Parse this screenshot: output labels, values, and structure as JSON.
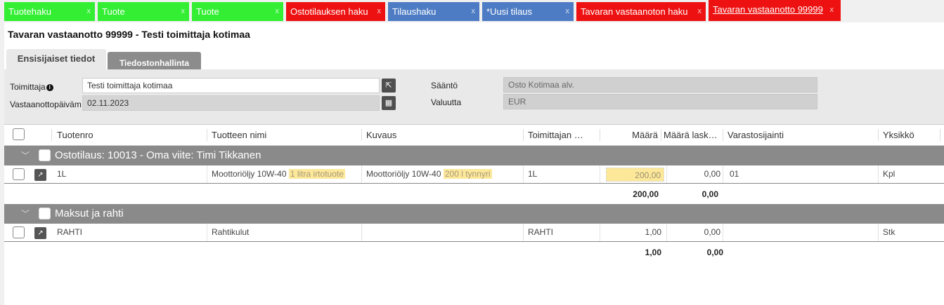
{
  "tabs": [
    {
      "label": "Tuotehaku",
      "close": "x"
    },
    {
      "label": "Tuote",
      "close": "x"
    },
    {
      "label": "Tuote",
      "close": "x"
    },
    {
      "label": "Ostotilauksen haku",
      "close": "x"
    },
    {
      "label": "Tilaushaku",
      "close": "x"
    },
    {
      "label": "*Uusi tilaus",
      "close": "x"
    },
    {
      "label": "Tavaran vastaanoton haku",
      "close": "x"
    },
    {
      "label": "Tavaran vastaanotto 99999",
      "close": "x"
    }
  ],
  "colors": {
    "green": "#33ee33",
    "red": "#ee1111",
    "blue": "#4d7cc4",
    "group": "#8a8a8a",
    "highlight": "#fde89a"
  },
  "page_title": "Tavaran vastaanotto 99999 - Testi toimittaja kotimaa",
  "subtabs": {
    "primary": "Ensisijaiset tiedot",
    "files": "Tiedostonhallinta"
  },
  "form": {
    "supplier_label": "Toimittaja",
    "supplier_info_icon": "i",
    "supplier_value": "Testi toimittaja kotimaa",
    "supplier_icon": "external-link-icon",
    "date_label": "Vastaanottopäivämäärä",
    "date_value": "02.11.2023",
    "date_icon": "calendar-icon",
    "rule_label": "Sääntö",
    "rule_value": "Osto Kotimaa alv.",
    "currency_label": "Valuutta",
    "currency_value": "EUR"
  },
  "columns": [
    "Tuotenro",
    "Tuotteen nimi",
    "Kuvaus",
    "Toimittajan tuotenumero",
    "Määrä",
    "Määrä laskutettu",
    "Varastosijainti",
    "Yksikkö"
  ],
  "groups": [
    {
      "title": "Ostotilaus: 10013 - Oma viite: Timi Tikkanen",
      "rows": [
        {
          "product_no": "1L",
          "name_plain": "Moottoriöljy 10W-40",
          "name_hl": "1 litra irtotuote",
          "desc_plain": "Moottoriöljy 10W-40",
          "desc_hl": "200 l tynnyri",
          "supplier_no": "1L",
          "qty": "200,00",
          "qty_invoiced": "0,00",
          "location": "01",
          "unit": "Kpl"
        }
      ],
      "sum_qty": "200,00",
      "sum_invoiced": "0,00"
    },
    {
      "title": "Maksut ja rahti",
      "rows": [
        {
          "product_no": "RAHTI",
          "name_plain": "Rahtikulut",
          "name_hl": "",
          "desc_plain": "",
          "desc_hl": "",
          "supplier_no": "RAHTI",
          "qty": "1,00",
          "qty_invoiced": "0,00",
          "location": "",
          "unit": "Stk"
        }
      ],
      "sum_qty": "1,00",
      "sum_invoiced": "0,00"
    }
  ]
}
